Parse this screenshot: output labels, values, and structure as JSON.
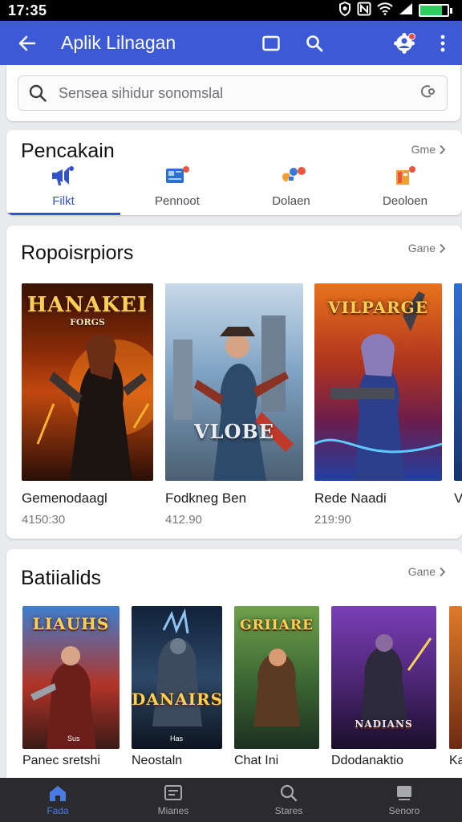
{
  "status_bar": {
    "time": "17:35",
    "battery_level": 0.8
  },
  "app_bar": {
    "title": "Aplik Lilnagan"
  },
  "search": {
    "placeholder": "Sensea sihidur sonomslal"
  },
  "categories": {
    "title": "Pencakain",
    "see_all": "Gme",
    "tabs": [
      {
        "label": "Filkt",
        "icon": "megaphone-icon",
        "active": true
      },
      {
        "label": "Pennoot",
        "icon": "card-icon",
        "active": false
      },
      {
        "label": "Dolaen",
        "icon": "controller-icon",
        "active": false
      },
      {
        "label": "Deoloen",
        "icon": "package-icon",
        "active": false
      }
    ]
  },
  "featured": {
    "title": "Ropoisrpiors",
    "see_all": "Gane",
    "games": [
      {
        "name": "Gemenodaagl",
        "meta": "4150:30",
        "logo": "HANAKEI",
        "logo_sub": "FORGS",
        "theme": "fire"
      },
      {
        "name": "Fodkneg Ben",
        "meta": "412.90",
        "logo": "VLOBE",
        "logo_sub": "",
        "theme": "sky"
      },
      {
        "name": "Rede Naadi",
        "meta": "219:90",
        "logo": "VILPARGE",
        "logo_sub": "",
        "theme": "neon"
      },
      {
        "name": "V",
        "meta": "",
        "logo": "",
        "logo_sub": "",
        "theme": "blue"
      }
    ]
  },
  "battles": {
    "title": "Batiialids",
    "see_all": "Gane",
    "games": [
      {
        "name": "Panec sretshi",
        "meta": "",
        "logo": "LIAUHS",
        "logo_sub": "",
        "badge": "Sus",
        "theme": "red"
      },
      {
        "name": "Neostaln",
        "meta": "",
        "logo": "DANAIRS",
        "logo_sub": "",
        "badge": "Has",
        "theme": "dark"
      },
      {
        "name": "Chat Ini",
        "meta": "",
        "logo": "GRIIARE",
        "logo_sub": "",
        "badge": "",
        "theme": "green"
      },
      {
        "name": "Ddodanaktio",
        "meta": "",
        "logo": "NADIANS",
        "logo_sub": "",
        "badge": "",
        "theme": "purple"
      },
      {
        "name": "Ka",
        "meta": "",
        "logo": "",
        "logo_sub": "",
        "badge": "",
        "theme": "orange"
      }
    ]
  },
  "bottom_nav": [
    {
      "label": "Fada",
      "icon": "home-icon",
      "active": true
    },
    {
      "label": "Mianes",
      "icon": "window-icon",
      "active": false
    },
    {
      "label": "Stares",
      "icon": "search-icon",
      "active": false
    },
    {
      "label": "Senoro",
      "icon": "stack-icon",
      "active": false
    }
  ]
}
